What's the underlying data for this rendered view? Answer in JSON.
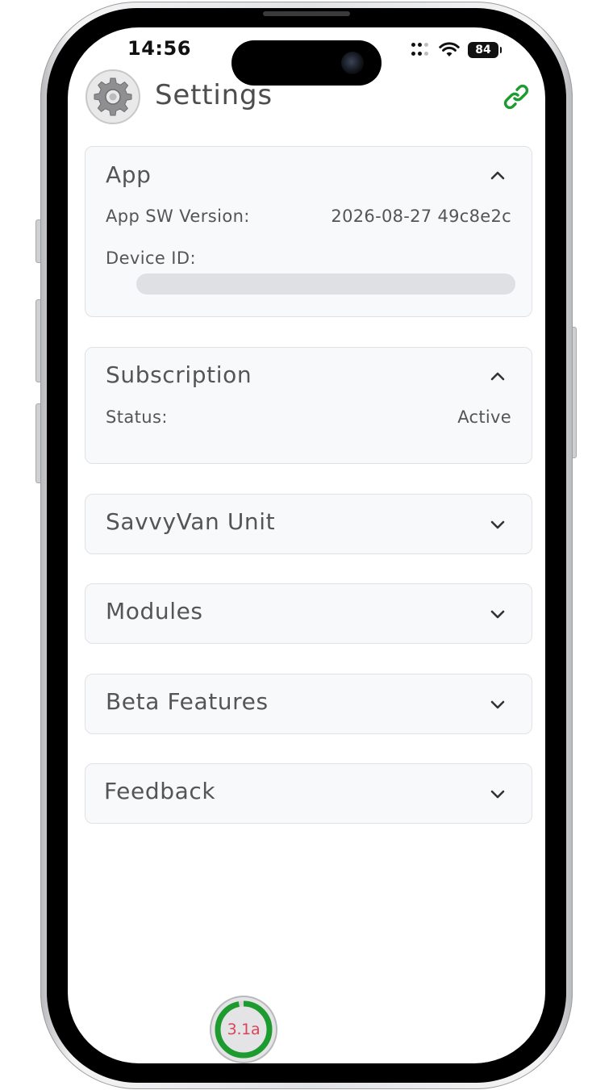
{
  "status_bar": {
    "time": "14:56",
    "battery": "84"
  },
  "header": {
    "title": "Settings"
  },
  "colors": {
    "accent_green": "#1e9b2f",
    "gauge_text": "#d9445a",
    "card_bg": "#f8f9fa"
  },
  "icons": {
    "header": "gear-icon",
    "connection": "link-icon",
    "expanded": "chevron-up-icon",
    "collapsed": "chevron-down-icon"
  },
  "sections": {
    "app": {
      "title": "App",
      "rows": [
        {
          "label": "App SW Version:",
          "value": "2026-08-27 49c8e2c"
        },
        {
          "label": "Device ID:"
        }
      ]
    },
    "subscription": {
      "title": "Subscription",
      "rows": [
        {
          "label": "Status:",
          "value": "Active"
        }
      ]
    },
    "savvyvan_unit": {
      "title": "SavvyVan Unit"
    },
    "modules": {
      "title": "Modules"
    },
    "beta_features": {
      "title": "Beta Features"
    },
    "feedback": {
      "title": "Feedback"
    }
  },
  "gauge": {
    "value": "3.1a",
    "level": 0.97
  }
}
